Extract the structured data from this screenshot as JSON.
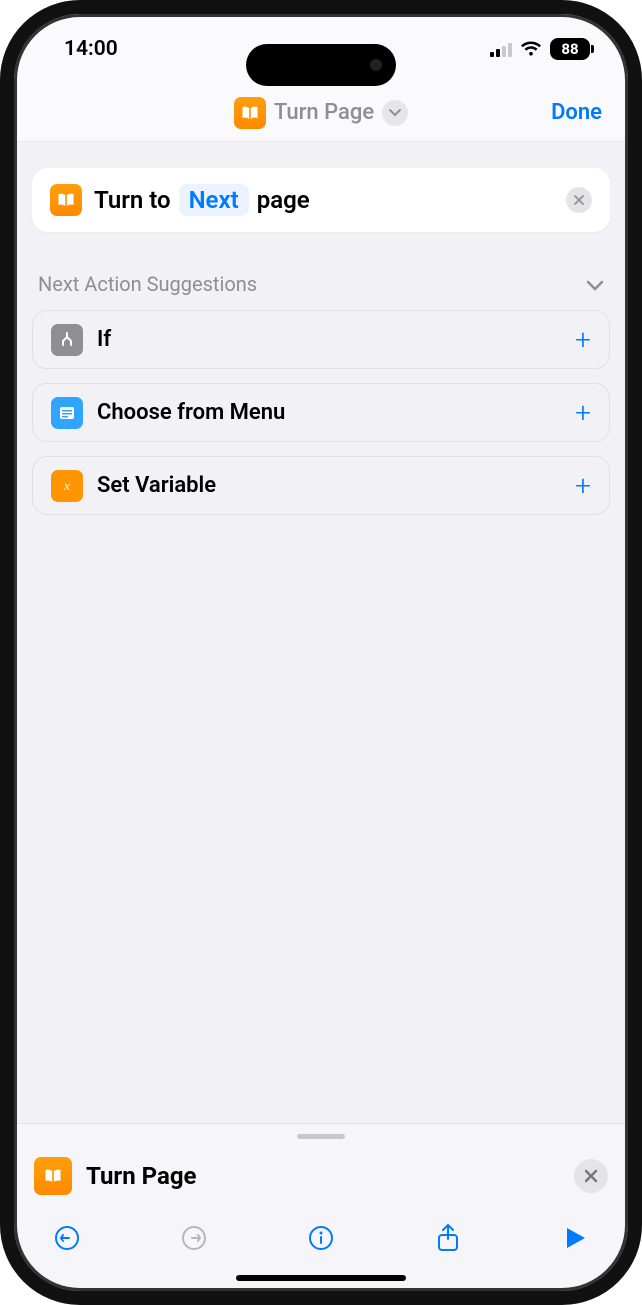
{
  "status": {
    "time": "14:00",
    "battery": "88"
  },
  "nav": {
    "title": "Turn Page",
    "done": "Done"
  },
  "action": {
    "prefix": "Turn to",
    "token": "Next",
    "suffix": "page"
  },
  "suggestions": {
    "header": "Next Action Suggestions",
    "items": [
      {
        "label": "If"
      },
      {
        "label": "Choose from Menu"
      },
      {
        "label": "Set Variable"
      }
    ]
  },
  "panel": {
    "title": "Turn Page"
  }
}
